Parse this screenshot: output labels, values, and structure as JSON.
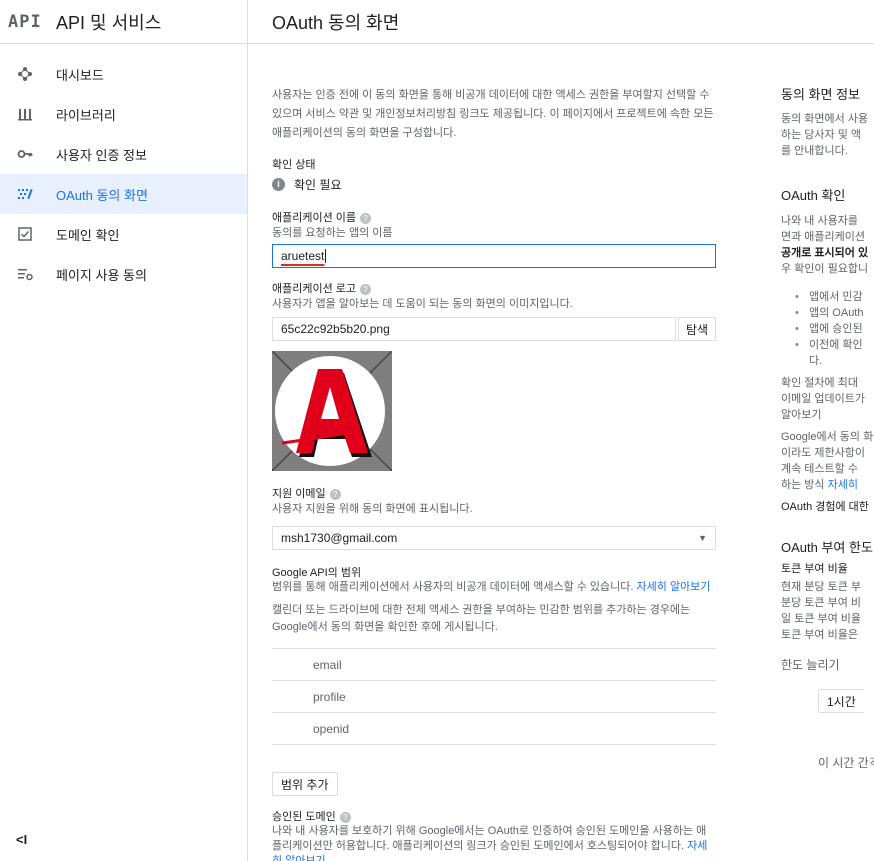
{
  "brand": {
    "logo": "API",
    "title": "API 및 서비스"
  },
  "sidebar": {
    "items": [
      {
        "label": "대시보드",
        "icon": "dashboard-icon",
        "active": false
      },
      {
        "label": "라이브러리",
        "icon": "library-icon",
        "active": false
      },
      {
        "label": "사용자 인증 정보",
        "icon": "key-icon",
        "active": false
      },
      {
        "label": "OAuth 동의 화면",
        "icon": "consent-screen-icon",
        "active": true
      },
      {
        "label": "도메인 확인",
        "icon": "checkbox-icon",
        "active": false
      },
      {
        "label": "페이지 사용 동의",
        "icon": "settings-list-icon",
        "active": false
      }
    ],
    "collapse": "<I"
  },
  "header": {
    "title": "OAuth 동의 화면"
  },
  "form": {
    "intro": "사용자는 인증 전에 이 동의 화면을 통해 비공개 데이터에 대한 액세스 권한을 부여할지 선택할 수 있으며 서비스 약관 및 개인정보처리방침 링크도 제공됩니다. 이 페이지에서 프로젝트에 속한 모든 애플리케이션의 동의 화면을 구성합니다.",
    "verification": {
      "label": "확인 상태",
      "value": "확인 필요"
    },
    "app_name": {
      "label": "애플리케이션 이름",
      "hint": "동의를 요청하는 앱의 이름",
      "value": "aruetest"
    },
    "app_logo": {
      "label": "애플리케이션 로고",
      "hint": "사용자가 앱을 알아보는 데 도움이 되는 동의 화면의 이미지입니다.",
      "filename": "65c22c92b5b20.png",
      "browse": "탐색"
    },
    "support_email": {
      "label": "지원 이메일",
      "hint": "사용자 지원을 위해 동의 화면에 표시됩니다.",
      "value": "msh1730@gmail.com"
    },
    "scopes": {
      "label": "Google API의 범위",
      "hint": "범위를 통해 애플리케이션에서 사용자의 비공개 데이터에 액세스할 수 있습니다.",
      "learn_more": "자세히 알아보기",
      "note": "캘린더 또는 드라이브에 대한 전체 액세스 권한을 부여하는 민감한 범위를 추가하는 경우에는 Google에서 동의 화면을 확인한 후에 게시됩니다.",
      "items": [
        "email",
        "profile",
        "openid"
      ],
      "add_button": "범위 추가"
    },
    "domains": {
      "label": "승인된 도메인",
      "hint": "나와 내 사용자를 보호하기 위해 Google에서는 OAuth로 인증하여 승인된 도메인을 사용하는 애플리케이션만 허용합니다. 애플리케이션의 링크가 승인된 도메인에서 호스팅되어야 합니다.",
      "learn_more": "자세히 알아보기"
    }
  },
  "right_panel": {
    "s1_title": "동의 화면 정보",
    "s1_lines": [
      "동의 화면에서 사용",
      "하는 당사자 및 액",
      "를 안내합니다."
    ],
    "s2_title": "OAuth 확인",
    "s2_lines": [
      "나와 내 사용자를",
      "면과 애플리케이션",
      "공개로 표시되어 있",
      "우 확인이 필요합니"
    ],
    "s2_bullets": [
      "앱에서 민감",
      "앱의 OAuth",
      "앱에 승인된",
      "이전에 확인"
    ],
    "s2_bullet_tail": "다.",
    "s3_lines": [
      "확인 절차에 최대",
      "이메일 업데이트가"
    ],
    "s3_link": "알아보기",
    "s4_lines": [
      "Google에서 동의 화",
      "이라도 제한사항이",
      "계속 테스트할 수",
      "하는 방식"
    ],
    "s4_link": "자세히",
    "s5_line": "OAuth 경험에 대한",
    "s6_title": "OAuth 부여 한도",
    "s6_sub": "토큰 부여 비율",
    "s6_lines": [
      "현재 분당 토큰 부",
      "분당 토큰 부여 비",
      "일 토큰 부여 비율",
      "토큰 부여 비율은"
    ],
    "s6_link": "한도 늘리기",
    "s6_button": "1시간",
    "s6_footer": "이 시간 간격"
  }
}
